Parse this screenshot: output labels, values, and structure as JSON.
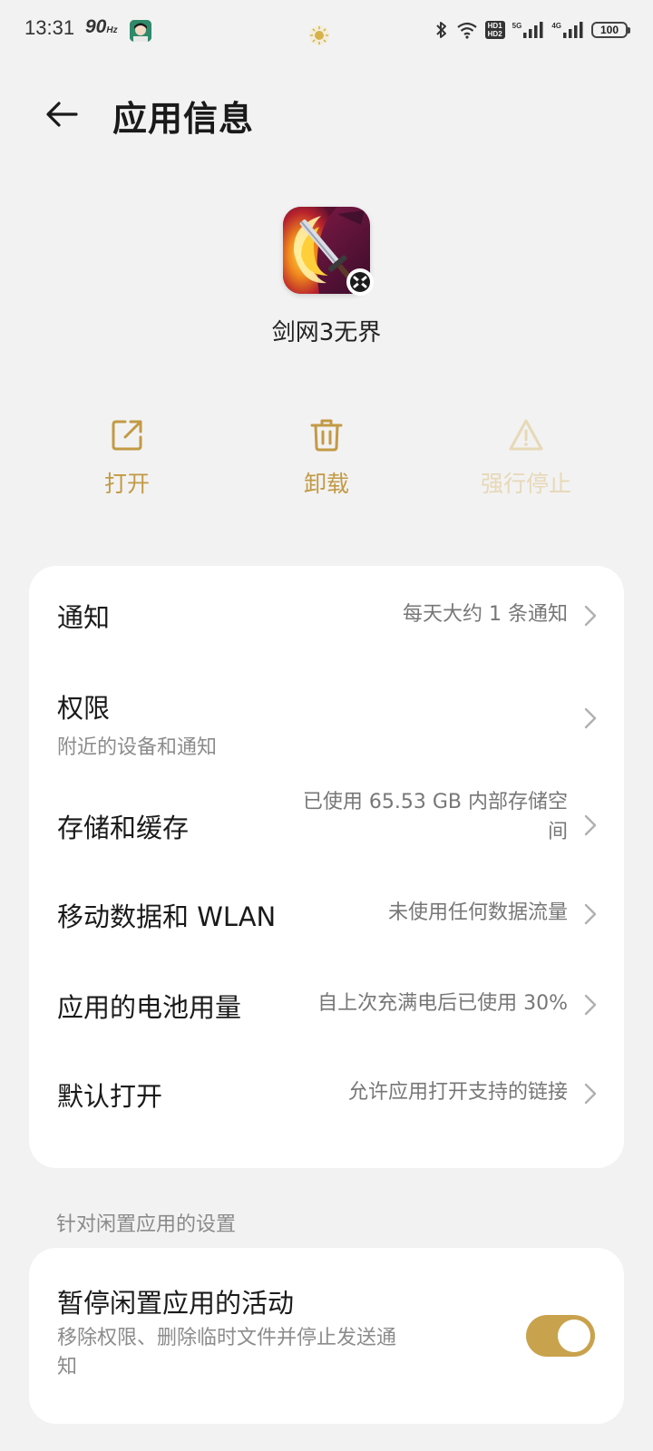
{
  "status_bar": {
    "time": "13:31",
    "refresh_rate": "90",
    "refresh_unit": "Hz",
    "hd_tag_1": "HD1",
    "hd_tag_2": "HD2",
    "net_1": "5G",
    "net_2": "4G",
    "battery": "100"
  },
  "header": {
    "title": "应用信息"
  },
  "app": {
    "name": "剑网3无界"
  },
  "actions": [
    {
      "label": "打开",
      "icon": "open-external-icon",
      "enabled": true
    },
    {
      "label": "卸载",
      "icon": "trash-icon",
      "enabled": true
    },
    {
      "label": "强行停止",
      "icon": "warning-icon",
      "enabled": false
    }
  ],
  "settings": {
    "notifications": {
      "title": "通知",
      "value": "每天大约 1 条通知"
    },
    "permissions": {
      "title": "权限",
      "subtitle": "附近的设备和通知"
    },
    "storage": {
      "title": "存储和缓存",
      "value_line1": "已使用 65.53 GB 内部存储空",
      "value_line2": "间"
    },
    "mobile_data": {
      "title": "移动数据和 WLAN",
      "value": "未使用任何数据流量"
    },
    "battery": {
      "title": "应用的电池用量",
      "value": "自上次充满电后已使用 30%"
    },
    "default_open": {
      "title": "默认打开",
      "value": "允许应用打开支持的链接"
    }
  },
  "idle_section": {
    "label": "针对闲置应用的设置",
    "pause_title": "暂停闲置应用的活动",
    "pause_sub_line1": "移除权限、删除临时文件并停止发送通",
    "pause_sub_line2": "知",
    "toggle_on": true
  },
  "colors": {
    "accent": "#c29a45",
    "accent_disabled": "#e7d8b7",
    "toggle": "#c9a24d",
    "background": "#f2f2f2",
    "card": "#ffffff"
  }
}
